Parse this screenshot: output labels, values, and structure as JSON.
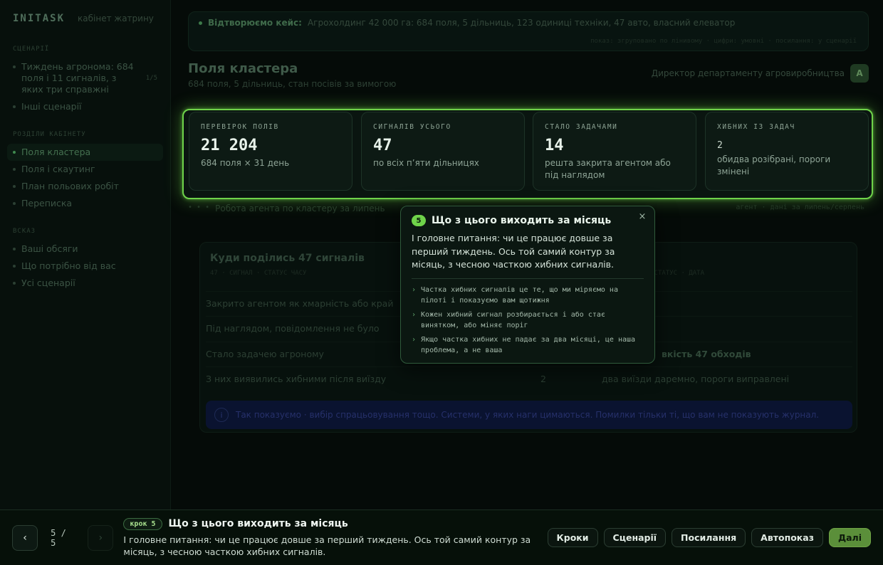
{
  "sidebar": {
    "brand": "INITASK",
    "brand_sub": "кабінет жатрину",
    "sections": [
      {
        "title": "СЦЕНАРІЇ",
        "items": [
          {
            "label": "Тиждень агронома: 684 поля і 11 сигналів, з яких три справжні",
            "count": "1/5"
          },
          {
            "label": "Інші сценарії"
          }
        ]
      },
      {
        "title": "РОЗДІЛИ КАБІНЕТУ",
        "items": [
          {
            "label": "Поля кластера",
            "active": true
          },
          {
            "label": "Поля і скаутинг"
          },
          {
            "label": "План польових робіт"
          },
          {
            "label": "Переписка"
          }
        ]
      },
      {
        "title": "ВСКАЗ",
        "items": [
          {
            "label": "Ваші обсяги"
          },
          {
            "label": "Що потрібно від вас"
          },
          {
            "label": "Усі сценарії"
          }
        ]
      }
    ]
  },
  "banner": {
    "label": "Відтворюємо кейс:",
    "text": "Агрохолдинг 42 000 га: 684 поля, 5 дільниць, 123 одиниці техніки, 47 авто, власний елеватор",
    "meta": "показ: згруповано по лінивому · цифри: умовні · посилання: у сценарії"
  },
  "page": {
    "title": "Поля кластера",
    "subtitle": "684 поля, 5 дільниць, стан посівів за вимогою",
    "user": "Директор департаменту агровиробництва",
    "avatar": "А"
  },
  "stats": [
    {
      "label": "Перевірок полів",
      "value": "21 204",
      "desc": "684 поля × 31 день"
    },
    {
      "label": "Сигналів усього",
      "value": "47",
      "desc": "по всіх п’яти дільницях"
    },
    {
      "label": "Стало задачами",
      "value": "14",
      "desc": "решта закрита агентом або під наглядом"
    },
    {
      "label": "Хибних із задач",
      "value": "2",
      "desc": "обидва розібрані, пороги змінені"
    }
  ],
  "runbar": {
    "dots": "• • •",
    "left": "Робота агента по кластеру за липень",
    "right": "агент · дані за липень/серпень"
  },
  "panel": {
    "title": "Куди поділись 47 сигналів",
    "sub_left": "47 · СИГНАЛ · СТАТУС ЧАСУ",
    "sub_right": "СТАТУС · ДАТА",
    "rows": [
      {
        "name": "Закрито агентом як хмарність або край",
        "count": "",
        "note": ""
      },
      {
        "name": "Під наглядом, повідомлення не було",
        "count": "",
        "note": ""
      },
      {
        "name": "Стало задачею агроному",
        "count": "",
        "note": "вкість 47 обходів"
      },
      {
        "name": "З них виявились хибними після виїзду",
        "count": "2",
        "note": "два виїзди даремно, пороги виправлені"
      }
    ],
    "notice_icon": "i",
    "notice": "Так показуємо · вибір спрацьовування тощо. Системи, у яких наги цимаються. Помилки тільки ті, що вам не показують журнал."
  },
  "popover": {
    "step": "5",
    "title": "Що з цього виходить за місяць",
    "close": "×",
    "text": "І головне питання: чи це працює довше за перший тиждень. Ось той самий контур за місяць, з чесною часткою хибних сигналів.",
    "bullets": [
      "Частка хибних сигналів це те, що ми міряємо на пілоті і показуємо вам щотижня",
      "Кожен хибний сигнал розбирається і або стає винятком, або міняє поріг",
      "Якщо частка хибних не падає за два місяці, це наша проблема, а не ваша"
    ],
    "bullet_marker": "›"
  },
  "tour": {
    "prev": "‹",
    "next": "›",
    "counter": "5 / 5",
    "pill": "крок 5",
    "title": "Що з цього виходить за місяць",
    "text": "І головне питання: чи це працює довше за перший тиждень. Ось той самий контур за місяць, з чесною часткою хибних сигналів.",
    "buttons": [
      "Кроки",
      "Сценарії",
      "Посилання",
      "Автопоказ",
      "Далі"
    ]
  }
}
